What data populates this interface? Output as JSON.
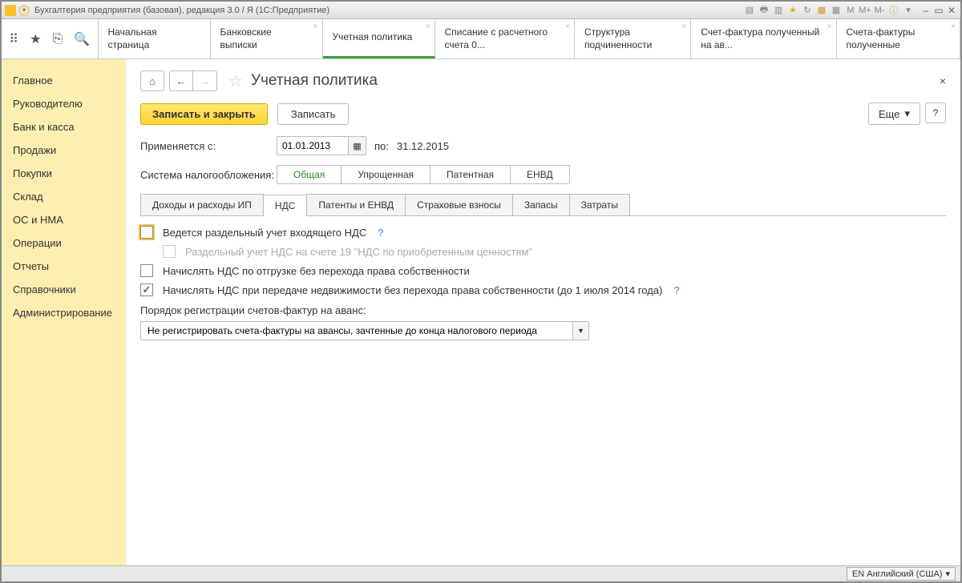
{
  "title": "Бухгалтерия предприятия (базовая), редакция 3.0 / Я  (1С:Предприятие)",
  "titlebar_labels": {
    "m": "M",
    "mplus": "M+",
    "mminus": "M-"
  },
  "tabs": [
    {
      "label": "Начальная страница"
    },
    {
      "label": "Банковские выписки"
    },
    {
      "label": "Учетная политика",
      "active": true
    },
    {
      "label": "Списание с расчетного счета 0..."
    },
    {
      "label": "Структура подчиненности"
    },
    {
      "label": "Счет-фактура полученный на ав..."
    },
    {
      "label": "Счета-фактуры полученные"
    }
  ],
  "sidebar": [
    "Главное",
    "Руководителю",
    "Банк и касса",
    "Продажи",
    "Покупки",
    "Склад",
    "ОС и НМА",
    "Операции",
    "Отчеты",
    "Справочники",
    "Администрирование"
  ],
  "page": {
    "title": "Учетная политика",
    "save_close": "Записать и закрыть",
    "save": "Записать",
    "more": "Еще",
    "help": "?",
    "applies_from": "Применяется с:",
    "date_from": "01.01.2013",
    "to": "по:",
    "date_to": "31.12.2015",
    "tax_label": "Система налогообложения:",
    "tax_opts": [
      "Общая",
      "Упрощенная",
      "Патентная",
      "ЕНВД"
    ],
    "inner_tabs": [
      "Доходы и расходы ИП",
      "НДС",
      "Патенты и ЕНВД",
      "Страховые взносы",
      "Запасы",
      "Затраты"
    ],
    "chk1": "Ведется раздельный учет входящего НДС",
    "chk1sub": "Раздельный учет НДС на счете 19 \"НДС по приобретенным ценностям\"",
    "chk2": "Начислять НДС по отгрузке без перехода права собственности",
    "chk3": "Начислять НДС при передаче недвижимости без перехода права собственности (до 1 июля 2014 года)",
    "reg_label": "Порядок регистрации счетов-фактур на аванс:",
    "reg_value": "Не регистрировать счета-фактуры на авансы, зачтенные до конца налогового периода"
  },
  "status": "EN Английский (США)"
}
